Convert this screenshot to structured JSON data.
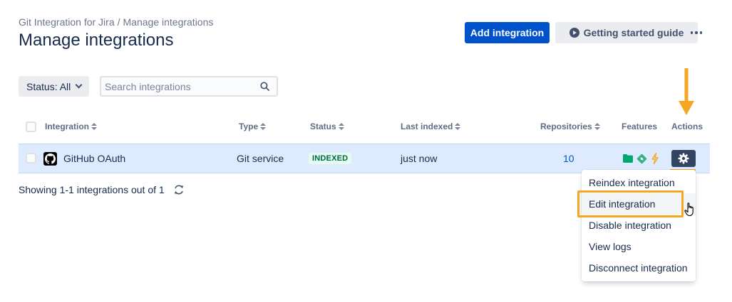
{
  "breadcrumb": {
    "app": "Git Integration for Jira",
    "separator": "/",
    "current": "Manage integrations"
  },
  "page_title": "Manage integrations",
  "header_actions": {
    "add_label": "Add integration",
    "guide_label": "Getting started guide",
    "guide_icon": "play-circle-icon",
    "more_icon": "more-icon"
  },
  "filters": {
    "status_label": "Status: All",
    "search_placeholder": "Search integrations"
  },
  "table": {
    "columns": [
      "Integration",
      "Type",
      "Status",
      "Last indexed",
      "Repositories",
      "Features",
      "Actions"
    ],
    "rows": [
      {
        "integration": "GitHub OAuth",
        "type": "Git service",
        "status": "INDEXED",
        "last_indexed": "just now",
        "repositories": "10",
        "features": [
          "folder-icon",
          "git-icon",
          "lightning-icon"
        ]
      }
    ]
  },
  "footer": {
    "showing": "Showing 1-1 integrations out of 1"
  },
  "actions_menu": {
    "items": [
      "Reindex integration",
      "Edit integration",
      "Disable integration",
      "View logs",
      "Disconnect integration"
    ],
    "hovered": "Edit integration"
  },
  "colors": {
    "primary": "#0052cc",
    "annotation": "#f5a623",
    "selected_row": "#deebff",
    "badge_bg": "#e3fcef",
    "badge_text": "#006644",
    "gear_button": "#344563"
  }
}
